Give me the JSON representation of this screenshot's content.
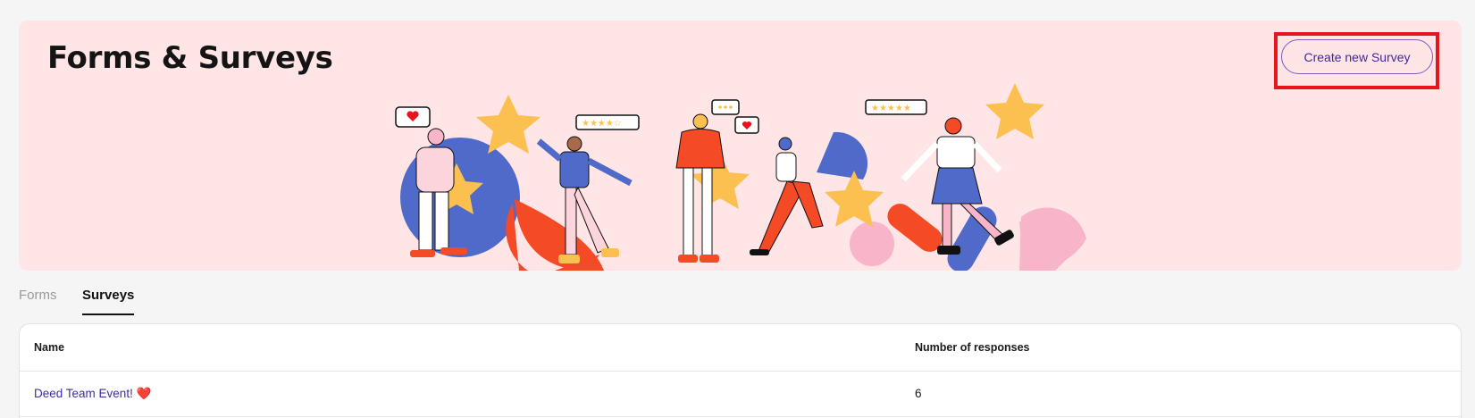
{
  "header": {
    "title": "Forms & Surveys",
    "create_button_label": "Create new Survey"
  },
  "tabs": [
    {
      "label": "Forms",
      "active": false
    },
    {
      "label": "Surveys",
      "active": true
    }
  ],
  "table": {
    "columns": [
      "Name",
      "Number of responses"
    ],
    "rows": [
      {
        "name": "Deed Team Event!",
        "emoji": "❤️",
        "responses": "6"
      }
    ]
  },
  "colors": {
    "hero_background": "#ffe5e5",
    "accent_purple": "#3f2a98",
    "highlight_red": "#e8141c",
    "illustration_blue": "#4f6ac9",
    "illustration_yellow": "#fbc04f",
    "illustration_red": "#f44a25",
    "illustration_pink": "#f8b4c8"
  },
  "icons": [
    "heart-bubble-icon",
    "star-rating-icon",
    "ellipsis-bubble-icon",
    "star-icon"
  ]
}
